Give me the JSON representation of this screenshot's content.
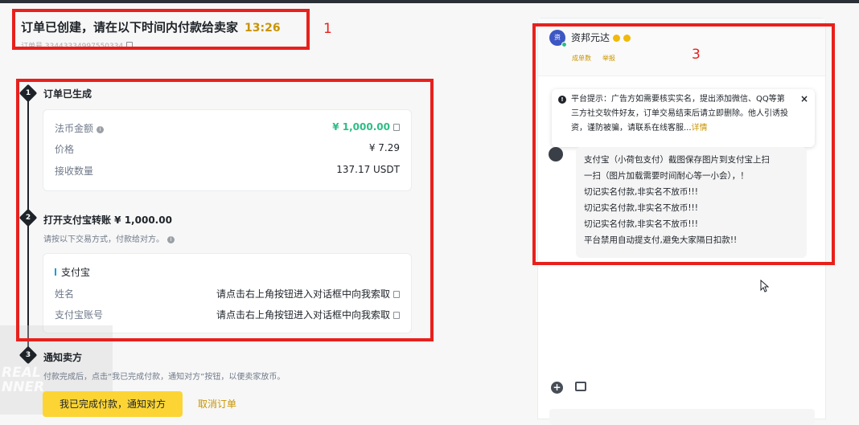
{
  "header": {
    "title": "订单已创建，请在以下时间内付款给卖家",
    "timer": "13:26",
    "order_id": "订单号 33443334997550334"
  },
  "steps": [
    {
      "num": "1",
      "title": "订单已生成"
    },
    {
      "num": "2",
      "title": "打开支付宝转账 ¥ 1,000.00",
      "subtitle": "请按以下交易方式，付款给对方。"
    },
    {
      "num": "3",
      "title": "通知卖方",
      "subtitle": "付款完成后，点击“我已完成付款，通知对方”按钮，以便卖家放币。"
    }
  ],
  "order": {
    "fiat_label": "法币金额",
    "fiat_value": "¥ 1,000.00",
    "price_label": "价格",
    "price_value": "¥ 7.29",
    "qty_label": "接收数量",
    "qty_value": "137.17 USDT"
  },
  "payment": {
    "method": "支付宝",
    "name_label": "姓名",
    "name_value": "请点击右上角按钮进入对话框中向我索取",
    "account_label": "支付宝账号",
    "account_value": "请点击右上角按钮进入对话框中向我索取"
  },
  "actions": {
    "done_label": "我已完成付款，通知对方",
    "cancel_label": "取消订单"
  },
  "watermark": {
    "line1": "REAL",
    "line2": "NNER"
  },
  "chat": {
    "merchant_name": "资邦元达",
    "avatar_letter": "资",
    "link1": "成单数",
    "link2": "举报",
    "notice_text": "平台提示：广告方如需要核实实名，提出添加微信、QQ等第三方社交软件好友，订单交易结束后请立即删除。他人引诱投资，谨防被骗，请联系在线客服...",
    "notice_more": "详情",
    "message_lines": [
      "支付宝（小荷包支付）截图保存图片到支付宝上扫",
      "一扫（图片加载需要时间耐心等一小会），！",
      "切记实名付款,非实名不放币!!!",
      "切记实名付款,非实名不放币!!!",
      "切记实名付款,非实名不放币!!!",
      "平台禁用自动提支付,避免大家隔日扣款!!"
    ]
  },
  "annotations": [
    "1",
    "2",
    "3"
  ],
  "colors": {
    "accent": "#fcd535",
    "green": "#2ebd85",
    "annotation": "#e8201c",
    "gold": "#c99400"
  }
}
